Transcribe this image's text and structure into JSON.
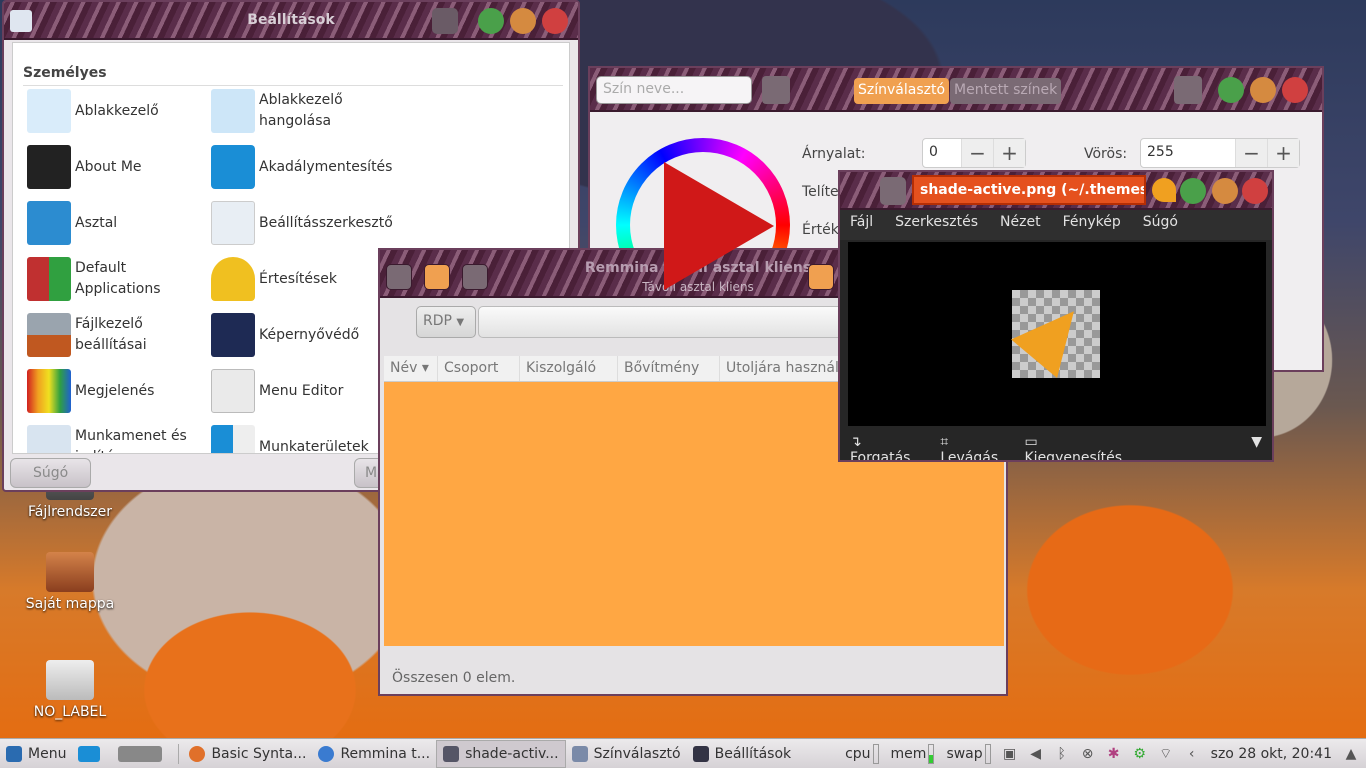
{
  "settings": {
    "title": "Beállítások",
    "section": "Személyes",
    "items": [
      {
        "label": "Ablakkezelő",
        "icon": "window-manager-icon"
      },
      {
        "label": "Ablakkezelő hangolása",
        "icon": "window-manager-tweaks-icon"
      },
      {
        "label": "About Me",
        "icon": "about-me-icon"
      },
      {
        "label": "Akadálymentesítés",
        "icon": "accessibility-icon"
      },
      {
        "label": "Asztal",
        "icon": "desktop-icon"
      },
      {
        "label": "Beállításszerkesztő",
        "icon": "settings-editor-icon"
      },
      {
        "label": "Default Applications",
        "icon": "default-applications-icon"
      },
      {
        "label": "Értesítések",
        "icon": "bell-icon"
      },
      {
        "label": "Fájlkezelő beállításai",
        "icon": "file-manager-settings-icon"
      },
      {
        "label": "Képernyővédő",
        "icon": "screensaver-icon"
      },
      {
        "label": "Megjelenés",
        "icon": "appearance-icon"
      },
      {
        "label": "Menu Editor",
        "icon": "menu-editor-icon"
      },
      {
        "label": "Munkamenet és indítás",
        "icon": "session-startup-icon"
      },
      {
        "label": "Munkaterületek",
        "icon": "workspaces-icon"
      }
    ],
    "help_button": "Súgó",
    "all_button": "Mi"
  },
  "colorpicker": {
    "placeholder": "Szín neve...",
    "tab_active": "Színválasztó",
    "tab_inactive": "Mentett színek",
    "hue_label": "Árnyalat:",
    "hue_value": "0",
    "sat_label": "Telítettség:",
    "val_label": "Érték:",
    "red_label": "Vörös:",
    "red_value": "255",
    "minus": "−",
    "plus": "+"
  },
  "remmina": {
    "title": "Remmina távoli asztal kliens",
    "subtitle": "Távoli asztal kliens",
    "protocol": "RDP",
    "columns": [
      "Név",
      "Csoport",
      "Kiszolgáló",
      "Bővítmény",
      "Utoljára használva"
    ],
    "status": "Összesen 0 elem."
  },
  "viewer": {
    "title": "shade-active.png (~/.themes/tr",
    "menu": [
      "Fájl",
      "Szerkesztés",
      "Nézet",
      "Fénykép",
      "Súgó"
    ],
    "tools": [
      "Forgatás",
      "Levágás",
      "Kiegyenesítés"
    ]
  },
  "desktop": {
    "icons": [
      "Fájlrendszer",
      "Saját mappa",
      "NO_LABEL"
    ]
  },
  "taskbar": {
    "menu": "Menu",
    "tasks": [
      "Basic Synta...",
      "Remmina t...",
      "shade-activ...",
      "Színválasztó",
      "Beállítások"
    ],
    "monitors": [
      "cpu",
      "mem",
      "swap"
    ],
    "clock": "szo 28 okt, 20:41"
  },
  "colors": {
    "accent_orange": "#e5511e",
    "list_bg": "#ffa743",
    "frame_purple": "#6b3f5c"
  }
}
